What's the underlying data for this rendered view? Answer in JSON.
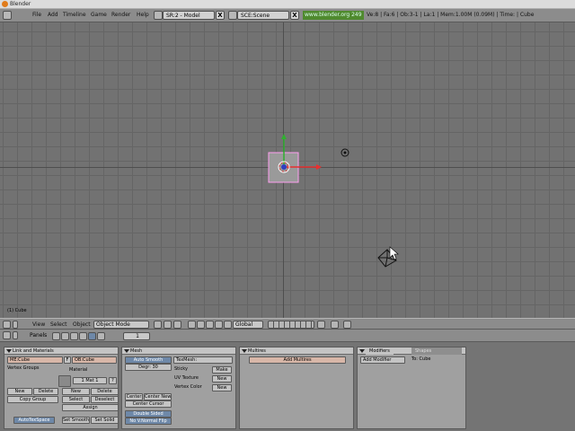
{
  "window": {
    "title": "Blender"
  },
  "menu": {
    "items": [
      "File",
      "Add",
      "Timeline",
      "Game",
      "Render",
      "Help"
    ],
    "screen_field": "SR:2 - Model",
    "scene_field": "SCE:Scene",
    "url": "www.blender.org 249",
    "stats": "Ve:8 | Fa:6 | Ob:3-1 | La:1  | Mem:1.00M (0.09M)  | Time: | Cube",
    "close_glyph": "X"
  },
  "viewport": {
    "object_label": "(1) Cube",
    "x_axis_color": "#e83030",
    "y_axis_color": "#30b030",
    "selected_color": "#ff9ff0"
  },
  "view_header": {
    "view": "View",
    "select": "Select",
    "object": "Object",
    "mode": "Object Mode",
    "orientation": "Global"
  },
  "panels_header": {
    "label": "Panels",
    "page": "1"
  },
  "panels": {
    "link": {
      "title": "Link and Materials",
      "me_field": "ME:Cube",
      "f_label": "F",
      "ob_field": "OB:Cube",
      "vertex_groups": "Vertex Groups",
      "material": "Material",
      "mat_counter": "1 Mat 1",
      "question": "?",
      "new": "New",
      "delete": "Delete",
      "copy_group": "Copy Group",
      "new2": "New",
      "delete2": "Delete",
      "select": "Select",
      "deselect": "Deselect",
      "assign": "Assign",
      "autotexspace": "AutoTexSpace",
      "set_smooth": "Set Smooth",
      "set_solid": "Set Solid"
    },
    "mesh": {
      "title": "Mesh",
      "auto_smooth": "Auto Smooth",
      "degr": "Degr: 30",
      "texmesh": "TexMesh:",
      "sticky": "Sticky",
      "make": "Make",
      "uv_texture": "UV Texture",
      "new_uv": "New",
      "vertex_color": "Vertex Color",
      "new_vc": "New",
      "center": "Center",
      "center_new": "Center New",
      "center_cursor": "Center Cursor",
      "double_sided": "Double Sided",
      "no_v_normal_flip": "No V.Normal Flip"
    },
    "multires": {
      "title": "Multires",
      "add_multires": "Add Multires"
    },
    "modifiers": {
      "tab_modifiers": "Modifiers",
      "tab_shapes": "Shapes",
      "add_modifier": "Add Modifier",
      "to_label": "To: Cube"
    }
  }
}
